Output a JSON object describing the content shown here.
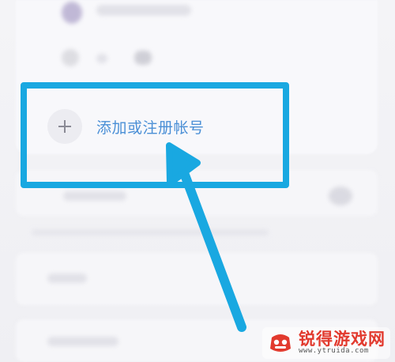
{
  "add_account": {
    "label": "添加或注册帐号",
    "icon": "plus-icon"
  },
  "watermark": {
    "name": "锐得游戏网",
    "url": "www.ytruida.com",
    "icon": "watermark-logo-icon"
  },
  "colors": {
    "highlight": "#19a8e1",
    "label": "#4a8fd6",
    "watermark_red": "#e23a2e"
  }
}
